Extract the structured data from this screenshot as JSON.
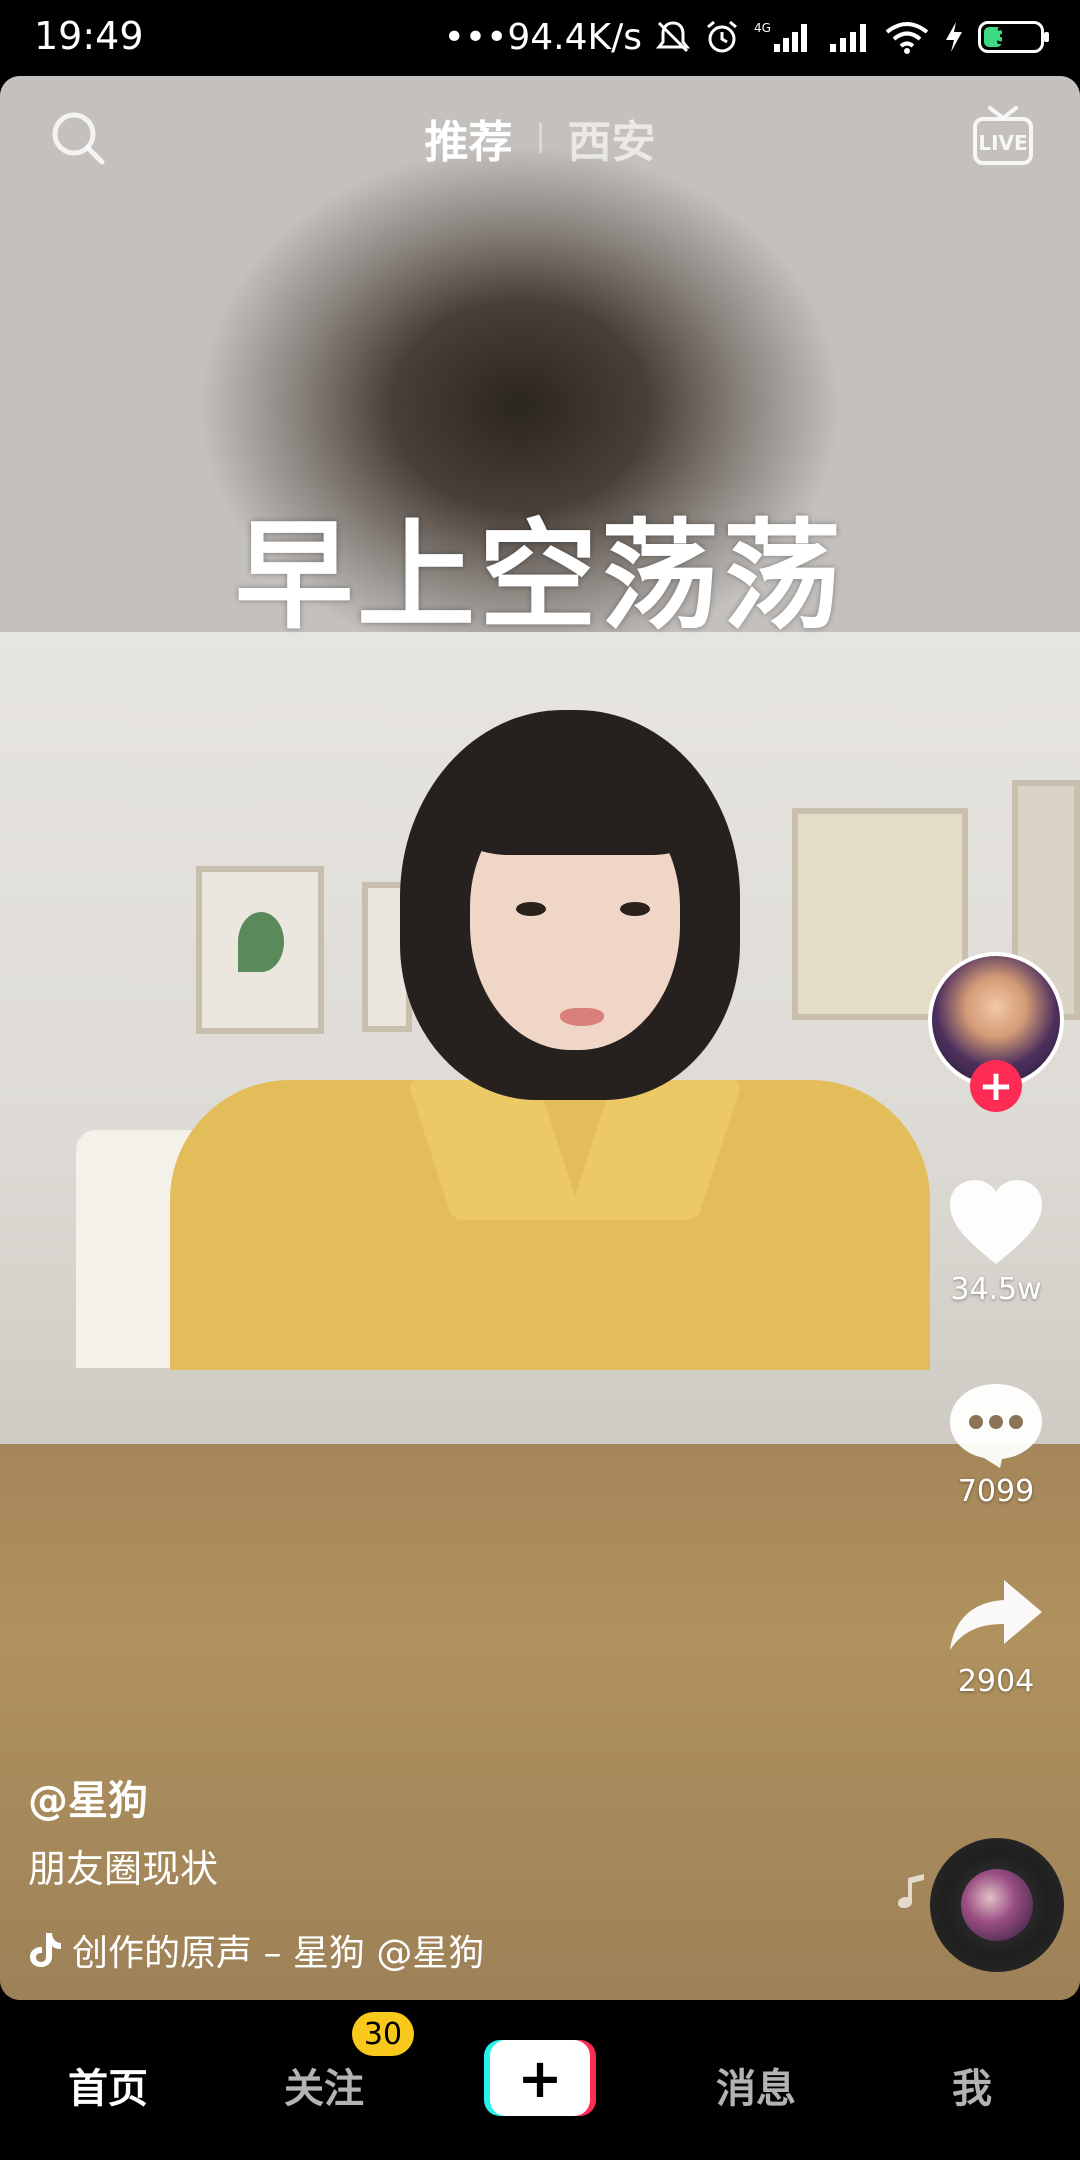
{
  "status_bar": {
    "time": "19:49",
    "net_speed": "•••94.4K/s",
    "battery": "30",
    "icons": [
      "bell-muted-icon",
      "alarm-icon",
      "signal-4g-icon",
      "signal-icon",
      "wifi-icon",
      "charging-icon",
      "battery-icon"
    ]
  },
  "top_nav": {
    "tabs": [
      {
        "label": "推荐",
        "active": true
      },
      {
        "label": "西安",
        "active": false
      }
    ],
    "left_icon": "search-icon",
    "right_icon": "live-icon"
  },
  "video": {
    "caption": "早上空荡荡"
  },
  "actions": {
    "like_count": "34.5w",
    "comment_count": "7099",
    "share_count": "2904"
  },
  "post": {
    "author": "@星狗",
    "description": "朋友圈现状",
    "music_text": "创作的原声 – 星狗    @星狗"
  },
  "tabbar": {
    "home": "首页",
    "following": "关注",
    "following_badge": "30",
    "create": "+",
    "messages": "消息",
    "me": "我"
  },
  "colors": {
    "accent_red": "#fe2c55",
    "accent_cyan": "#25f4ee",
    "badge_yellow": "#f8c81a"
  }
}
